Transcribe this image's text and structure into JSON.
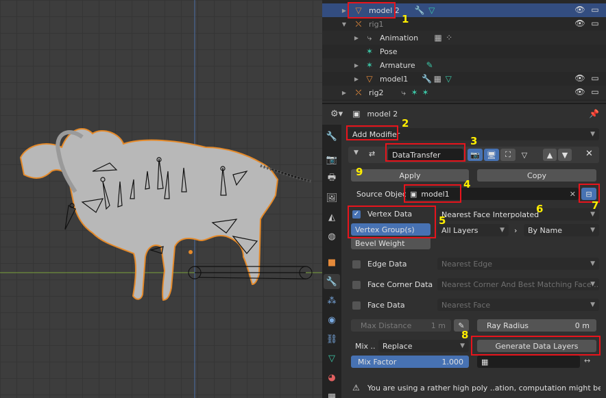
{
  "outliner": {
    "rows": [
      {
        "label": "model 2",
        "selected": true
      },
      {
        "label": "rig1"
      },
      {
        "label": "Animation"
      },
      {
        "label": "Pose"
      },
      {
        "label": "Armature"
      },
      {
        "label": "model1"
      },
      {
        "label": "rig2"
      }
    ]
  },
  "properties": {
    "object_name": "model 2",
    "add_modifier": "Add Modifier",
    "modifier_name": "DataTransfer",
    "apply": "Apply",
    "copy": "Copy",
    "source_object_label": "Source Object",
    "source_object_value": "model1",
    "vertex_data_label": "Vertex Data",
    "vertex_mapping": "Nearest Face Interpolated",
    "vertex_groups_option": "Vertex Group(s)",
    "bevel_weight_option": "Bevel Weight",
    "layers_source": "All Layers",
    "layers_dest": "By Name",
    "edge_data_label": "Edge Data",
    "edge_mapping": "Nearest Edge",
    "face_corner_label": "Face Corner Data",
    "face_corner_mapping": "Nearest Corner And Best Matching Face ...",
    "face_data_label": "Face Data",
    "face_mapping": "Nearest Face",
    "max_distance_label": "Max Distance",
    "max_distance_value": "1 m",
    "ray_radius_label": "Ray Radius",
    "ray_radius_value": "0 m",
    "mix_label": "Mix ..",
    "mix_mode": "Replace",
    "generate_layers": "Generate Data Layers",
    "mix_factor_label": "Mix Factor",
    "mix_factor_value": "1.000",
    "warning": "You are using a rather high poly ..ation, computation might be slow"
  },
  "annotations": [
    "1",
    "2",
    "3",
    "4",
    "5",
    "6",
    "7",
    "8",
    "9"
  ],
  "colors": {
    "highlight": "#e8141c",
    "number": "#ffee00",
    "selected_row": "#334d80",
    "accent_blue": "#4772b3"
  }
}
